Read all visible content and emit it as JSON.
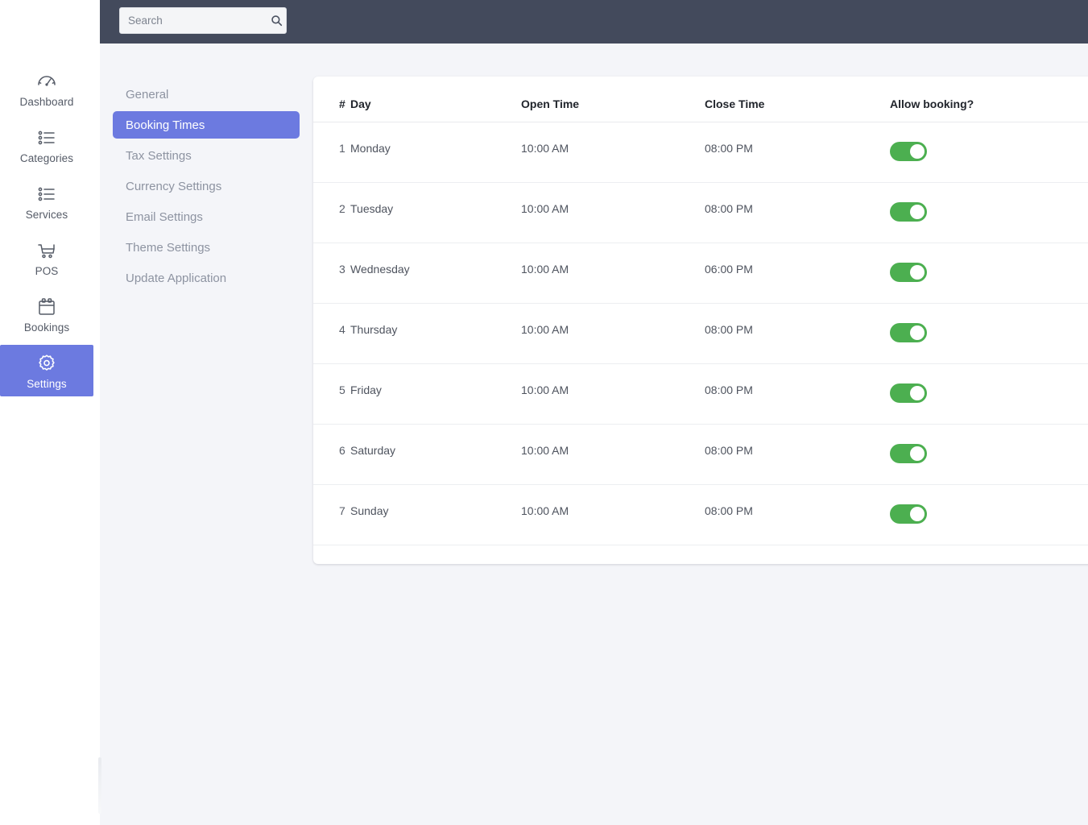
{
  "header": {
    "search": {
      "placeholder": "Search",
      "value": "",
      "icon": "search-icon"
    },
    "background_color": "#434a5c"
  },
  "sidebar": {
    "accent_color": "#6c7ae0",
    "items": [
      {
        "label": "Dashboard",
        "icon": "speedometer-icon",
        "active": false
      },
      {
        "label": "Categories",
        "icon": "list-icon",
        "active": false
      },
      {
        "label": "Services",
        "icon": "list-icon",
        "active": false
      },
      {
        "label": "POS",
        "icon": "shopping-cart-icon",
        "active": false
      },
      {
        "label": "Bookings",
        "icon": "calendar-icon",
        "active": false
      },
      {
        "label": "Settings",
        "icon": "gear-icon",
        "active": true
      }
    ]
  },
  "settings_nav": {
    "active_color": "#6c7ae0",
    "items": [
      {
        "label": "General",
        "active": false
      },
      {
        "label": "Booking Times",
        "active": true
      },
      {
        "label": "Tax Settings",
        "active": false
      },
      {
        "label": "Currency Settings",
        "active": false
      },
      {
        "label": "Email Settings",
        "active": false
      },
      {
        "label": "Theme Settings",
        "active": false
      },
      {
        "label": "Update Application",
        "active": false
      }
    ]
  },
  "booking_times_table": {
    "columns": [
      "#",
      "Day",
      "Open Time",
      "Close Time",
      "Allow booking?"
    ],
    "toggle_on_color": "#4caf50",
    "rows": [
      {
        "num": "1",
        "day": "Monday",
        "open_time": "10:00 AM",
        "close_time": "08:00 PM",
        "allow_booking": true
      },
      {
        "num": "2",
        "day": "Tuesday",
        "open_time": "10:00 AM",
        "close_time": "08:00 PM",
        "allow_booking": true
      },
      {
        "num": "3",
        "day": "Wednesday",
        "open_time": "10:00 AM",
        "close_time": "06:00 PM",
        "allow_booking": true
      },
      {
        "num": "4",
        "day": "Thursday",
        "open_time": "10:00 AM",
        "close_time": "08:00 PM",
        "allow_booking": true
      },
      {
        "num": "5",
        "day": "Friday",
        "open_time": "10:00 AM",
        "close_time": "08:00 PM",
        "allow_booking": true
      },
      {
        "num": "6",
        "day": "Saturday",
        "open_time": "10:00 AM",
        "close_time": "08:00 PM",
        "allow_booking": true
      },
      {
        "num": "7",
        "day": "Sunday",
        "open_time": "10:00 AM",
        "close_time": "08:00 PM",
        "allow_booking": true
      }
    ]
  }
}
